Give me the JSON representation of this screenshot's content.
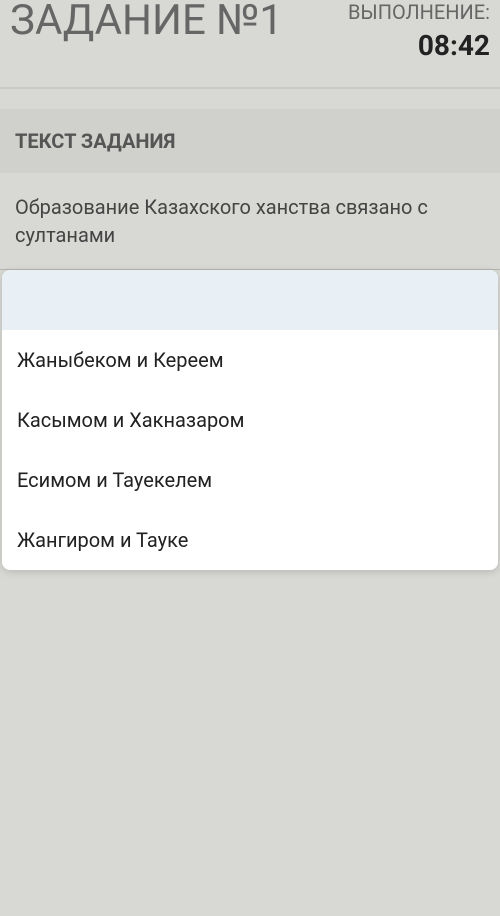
{
  "header": {
    "task_title": "ЗАДАНИЕ №1",
    "execution_label": "ВЫПОЛНЕНИЕ:",
    "time": "08:42"
  },
  "section": {
    "title": "ТЕКСТ ЗАДАНИЯ"
  },
  "question": {
    "text": "Образование Казахского ханства связано с султанами"
  },
  "options_header": "",
  "options": [
    "Жаныбеком и Кереем",
    "Касымом и Хакназаром",
    "Есимом и Тауекелем",
    "Жангиром и Тауке"
  ]
}
